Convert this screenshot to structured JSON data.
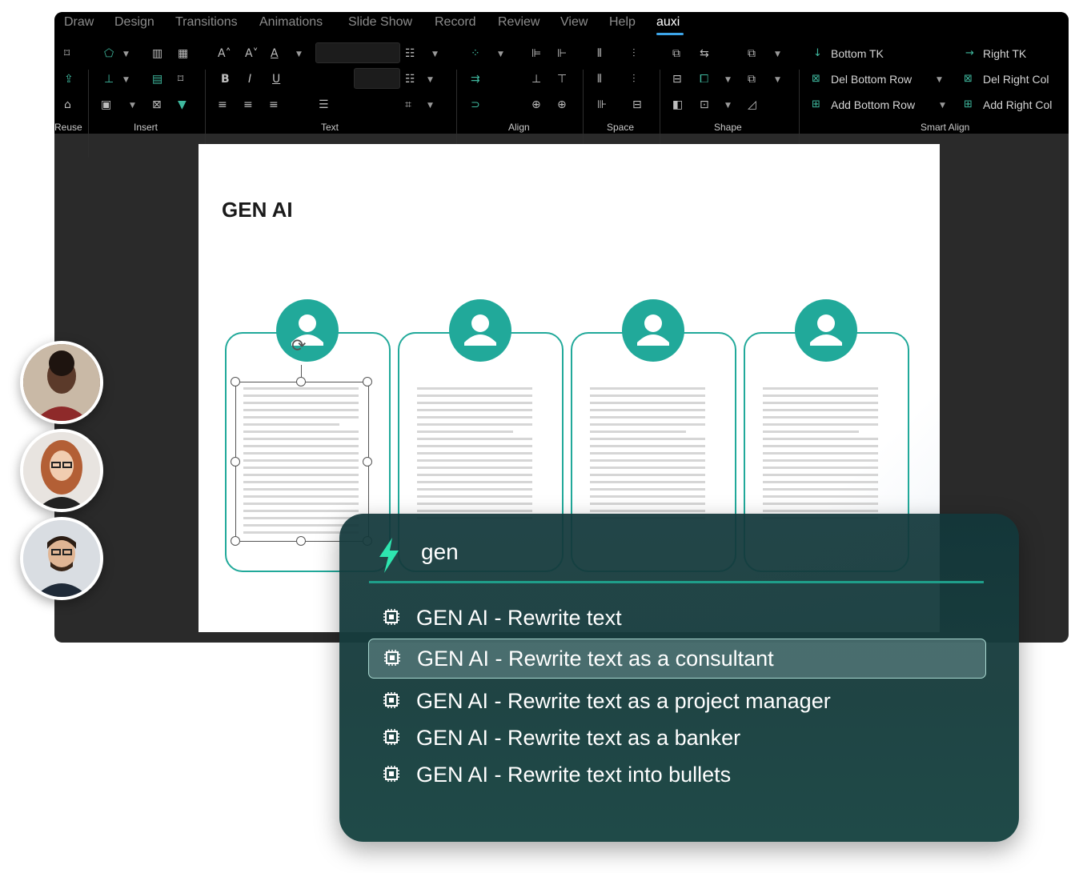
{
  "menu": {
    "tabs": [
      "Draw",
      "Design",
      "Transitions",
      "Animations",
      "Slide Show",
      "Record",
      "Review",
      "View",
      "Help",
      "auxi"
    ],
    "active_tab": "auxi"
  },
  "ribbon": {
    "groups": {
      "reuse": "Reuse",
      "insert": "Insert",
      "text": "Text",
      "align": "Align",
      "space": "Space",
      "shape": "Shape",
      "smart_align": "Smart Align"
    },
    "smart_align": {
      "bottom_tk": "Bottom TK",
      "right_tk": "Right TK",
      "del_bottom_row": "Del Bottom Row",
      "del_right_col": "Del Right Col",
      "add_bottom_row": "Add Bottom Row",
      "add_right_col": "Add Right Col"
    },
    "text_buttons": {
      "bold": "B",
      "italic": "I",
      "underline": "U"
    }
  },
  "slide": {
    "title": "GEN AI",
    "cards": 4
  },
  "palette": {
    "query": "gen",
    "items": [
      "GEN AI - Rewrite text",
      "GEN AI - Rewrite text as a consultant",
      "GEN AI - Rewrite text as a project manager",
      "GEN AI - Rewrite text as a banker",
      "GEN AI - Rewrite text into bullets"
    ],
    "selected_index": 1
  },
  "colors": {
    "accent_teal": "#21a99a",
    "tab_underline": "#3da5e8",
    "palette_bg": "#12373a",
    "lightning": "#2ee6b0"
  }
}
